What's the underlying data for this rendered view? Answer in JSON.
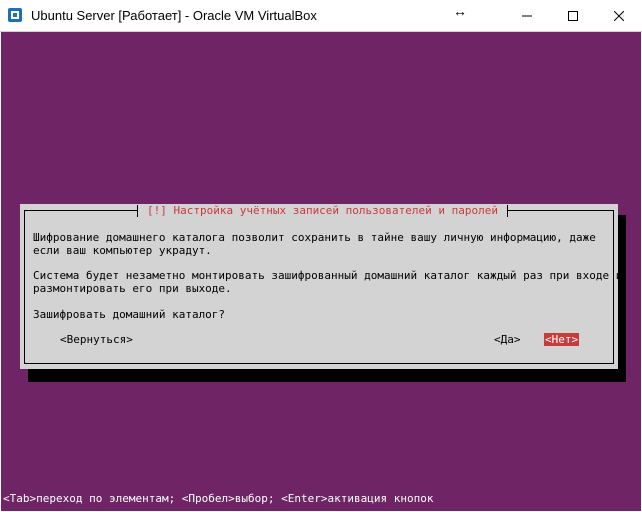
{
  "window": {
    "title": "Ubuntu Server [Работает] - Oracle VM VirtualBox"
  },
  "dialog": {
    "title": "[!] Настройка учётных записей пользователей и паролей",
    "lines": [
      "Шифрование домашнего каталога позволит сохранить в тайне вашу личную информацию, даже",
      "если ваш компьютер украдут.",
      "Система будет незаметно монтировать зашифрованный домашний каталог каждый раз при входе и",
      "размонтировать его при выходе.",
      "Зашифровать домашний каталог?"
    ],
    "back_label": "<Вернуться>",
    "yes_label": "<Да>",
    "no_label": "<Нет>"
  },
  "helpbar": {
    "text": "<Tab>переход по элементам; <Пробел>выбор; <Enter>активация кнопок"
  },
  "colors": {
    "console_bg": "#6f2466",
    "dialog_bg": "#d3d3d3",
    "accent_red": "#c73b3b"
  }
}
